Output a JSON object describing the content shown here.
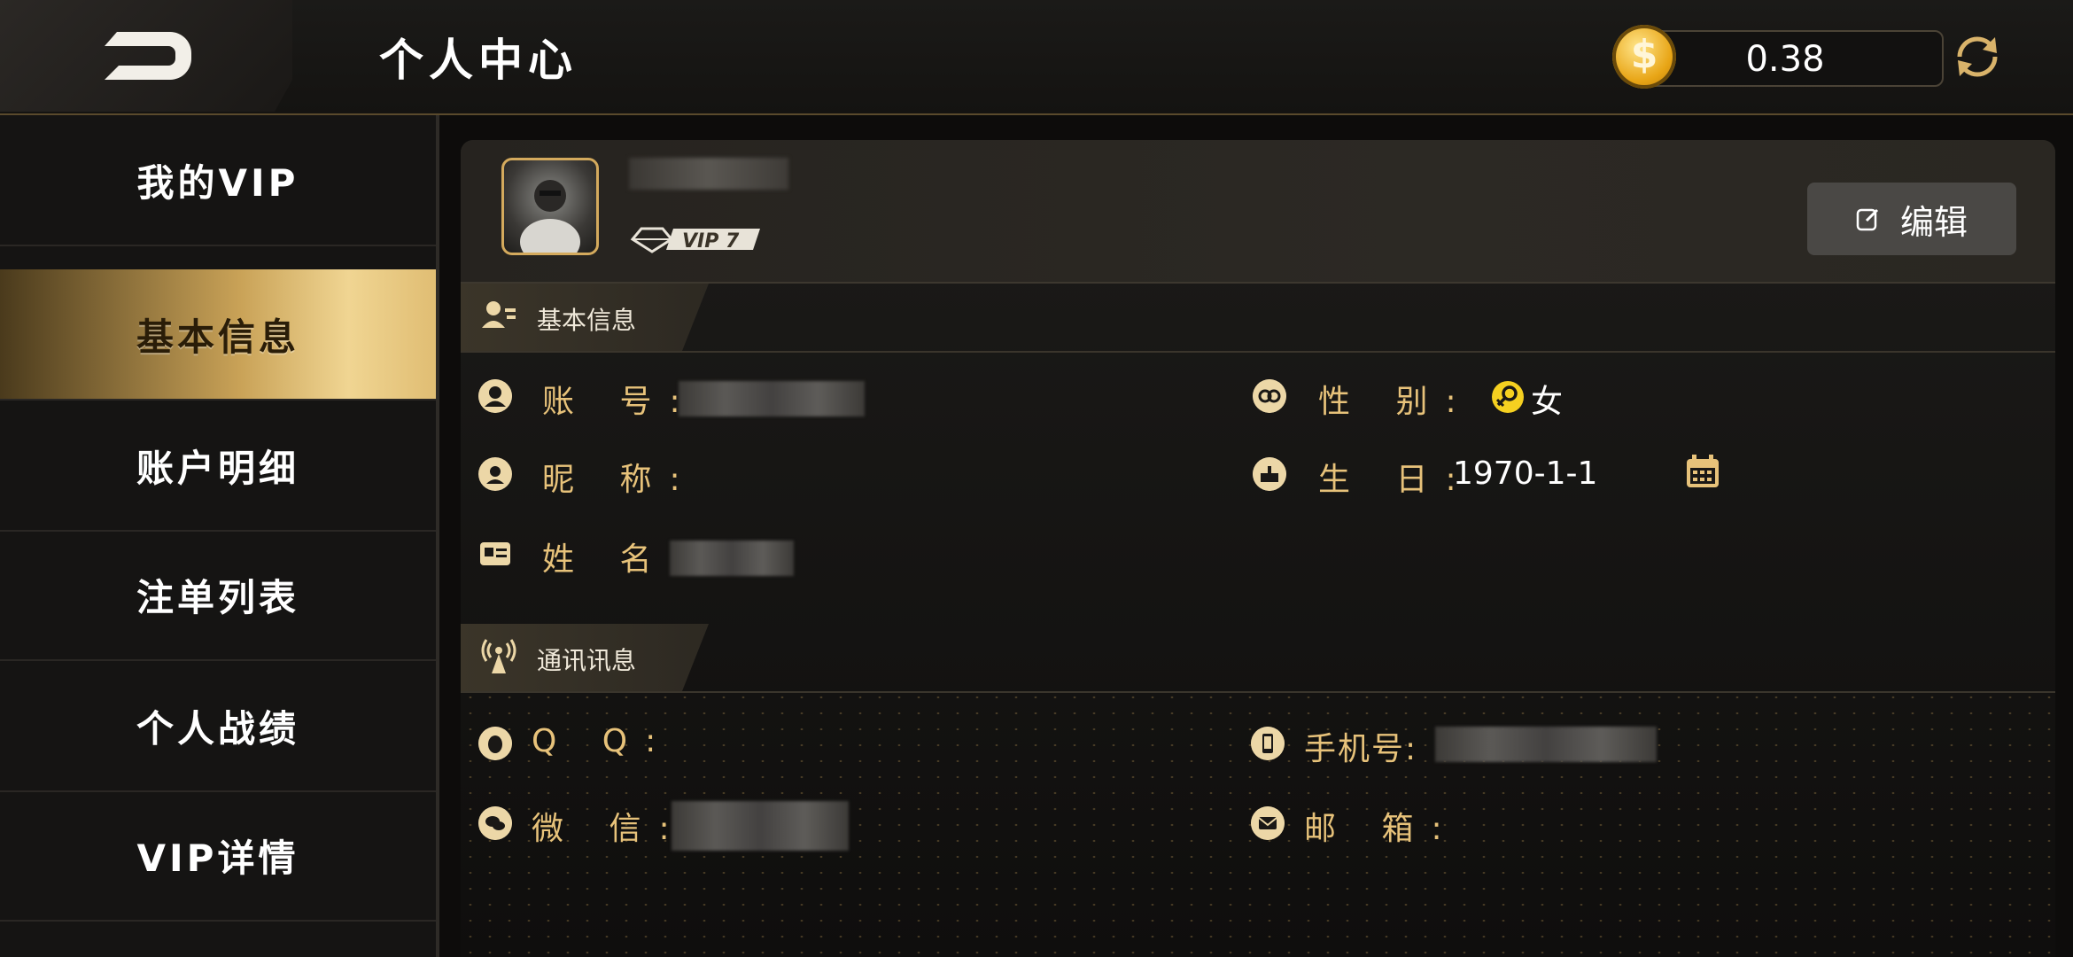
{
  "header": {
    "title": "个人中心",
    "balance": "0.38",
    "coin_symbol": "$"
  },
  "sidebar": {
    "items": [
      {
        "label": "我的VIP"
      },
      {
        "label": "基本信息",
        "active": true
      },
      {
        "label": "账户明细"
      },
      {
        "label": "注单列表"
      },
      {
        "label": "个人战绩"
      },
      {
        "label": "VIP详情"
      }
    ]
  },
  "profile": {
    "vip_level": "VIP 7",
    "edit_label": "编辑"
  },
  "basic_info": {
    "section_title": "基本信息",
    "account_label": "账 号:",
    "nickname_label": "昵 称:",
    "name_label": "姓 名:",
    "gender_label": "性 别:",
    "gender_value": "女",
    "birthday_label": "生 日:",
    "birthday_value": "1970-1-1"
  },
  "contact_info": {
    "section_title": "通讯讯息",
    "qq_label": "Q Q:",
    "wechat_label": "微 信:",
    "phone_label": "手机号:",
    "email_label": "邮 箱:"
  },
  "colors": {
    "accent_gold": "#e7c27a",
    "active_gold": "#c9a257"
  }
}
